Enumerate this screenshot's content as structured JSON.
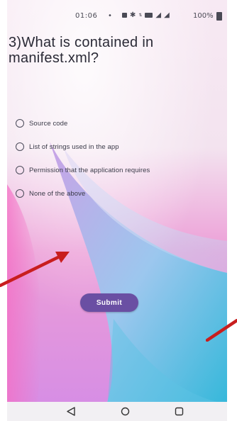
{
  "status_bar": {
    "time": "01:06",
    "battery": "100%"
  },
  "question": {
    "text": "3)What is contained in manifest.xml?"
  },
  "options": [
    {
      "label": "Source code"
    },
    {
      "label": "List of strings used in the app"
    },
    {
      "label": "Permission that the application requires"
    },
    {
      "label": "None of the above"
    }
  ],
  "submit": {
    "label": "Submit"
  },
  "nav": {
    "back_icon": "back-triangle-icon",
    "home_icon": "home-circle-icon",
    "recent_icon": "recent-square-icon"
  },
  "colors": {
    "accent": "#6a4fa3",
    "annotation_arrow": "#c81e1e"
  }
}
